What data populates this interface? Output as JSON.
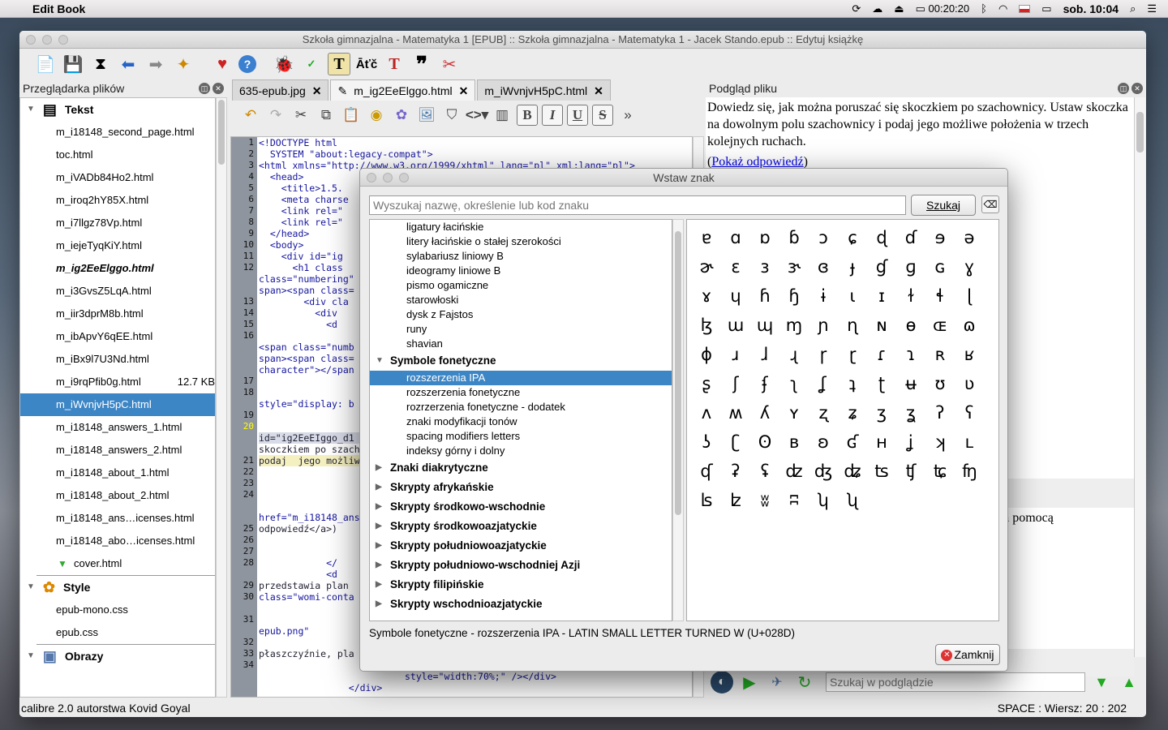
{
  "menubar": {
    "app_name": "Edit Book",
    "time_badge": "00:20:20",
    "clock": "sob. 10:04"
  },
  "window": {
    "title": "Szkoła gimnazjalna - Matematyka 1 [EPUB] :: Szkoła gimnazjalna - Matematyka 1 - Jacek Stando.epub :: Edytuj książkę"
  },
  "file_browser": {
    "title": "Przeglądarka plików",
    "text_category": "Tekst",
    "files": [
      {
        "name": "m_i18148_second_page.html"
      },
      {
        "name": "toc.html"
      },
      {
        "name": "m_iVADb84Ho2.html"
      },
      {
        "name": "m_iroq2hY85X.html"
      },
      {
        "name": "m_i7llgz78Vp.html"
      },
      {
        "name": "m_iejeTyqKiY.html"
      },
      {
        "name": "m_ig2EeElggo.html"
      },
      {
        "name": "m_i3GvsZ5LqA.html"
      },
      {
        "name": "m_iir3dprM8b.html"
      },
      {
        "name": "m_ibApvY6qEE.html"
      },
      {
        "name": "m_iBx9l7U3Nd.html"
      },
      {
        "name": "m_i9rqPfib0g.html",
        "size": "12.7 KB"
      },
      {
        "name": "m_iWvnjvH5pC.html"
      },
      {
        "name": "m_i18148_answers_1.html"
      },
      {
        "name": "m_i18148_answers_2.html"
      },
      {
        "name": "m_i18148_about_1.html"
      },
      {
        "name": "m_i18148_about_2.html"
      },
      {
        "name": "m_i18148_ans…icenses.html"
      },
      {
        "name": "m_i18148_abo…icenses.html"
      },
      {
        "name": "cover.html"
      }
    ],
    "style_category": "Style",
    "styles": [
      {
        "name": "epub-mono.css"
      },
      {
        "name": "epub.css"
      }
    ],
    "images_category": "Obrazy"
  },
  "editor": {
    "tabs": [
      {
        "label": "635-epub.jpg"
      },
      {
        "label": "m_ig2EeElggo.html"
      },
      {
        "label": "m_iWvnjvH5pC.html"
      }
    ],
    "line_numbers": [
      "1",
      "2",
      "3",
      "4",
      "5",
      "6",
      "7",
      "8",
      "9",
      "10",
      "11",
      "12",
      "",
      "",
      "13",
      "14",
      "15",
      "16",
      "",
      "",
      "",
      "17",
      "18",
      "",
      "19",
      "20",
      "",
      "",
      "21",
      "22",
      "23",
      "24",
      "",
      "",
      "25",
      "26",
      "27",
      "28",
      "",
      "29",
      "30",
      "",
      "31",
      "",
      "32",
      "33",
      "34"
    ],
    "code_lines": [
      {
        "text": "<!DOCTYPE html",
        "c": "t"
      },
      {
        "text": "  SYSTEM \"about:legacy-compat\">",
        "c": "t"
      },
      {
        "text": "<html xmlns=\"http://www.w3.org/1999/xhtml\" lang=\"pl\" xml:lang=\"pl\">",
        "c": "t"
      },
      {
        "text": "  <head>",
        "c": "t"
      },
      {
        "text": "    <title>1.5.",
        "c": "t"
      },
      {
        "text": "    <meta charse",
        "c": "t"
      },
      {
        "text": "    <link rel=\"",
        "c": "t"
      },
      {
        "text": "    <link rel=\"",
        "c": "t"
      },
      {
        "text": "  </head>",
        "c": "t"
      },
      {
        "text": "  <body>",
        "c": "t"
      },
      {
        "text": "    <div id=\"ig",
        "c": "t"
      },
      {
        "text": "      <h1 class",
        "c": "t"
      },
      {
        "text": "class=\"numbering\"",
        "c": "t"
      },
      {
        "text": "span><span class=",
        "c": "t"
      },
      {
        "text": "        <div cla",
        "c": "t"
      },
      {
        "text": "          <div ",
        "c": "t"
      },
      {
        "text": "            <d",
        "c": "t"
      },
      {
        "text": "",
        "c": ""
      },
      {
        "text": "<span class=\"numb",
        "c": "t"
      },
      {
        "text": "span><span class=",
        "c": "t"
      },
      {
        "text": "character\"></span",
        "c": "t"
      },
      {
        "text": "",
        "c": ""
      },
      {
        "text": "",
        "c": ""
      },
      {
        "text": "style=\"display: b",
        "c": "t"
      },
      {
        "text": "",
        "c": ""
      },
      {
        "text": "",
        "c": ""
      },
      {
        "text": "id=\"ig2EeEIggo_d1",
        "c": "hb"
      },
      {
        "text": "skoczkiem po szach",
        "c": ""
      },
      {
        "text": "podaj  jego możliw",
        "c": "hl"
      },
      {
        "text": "",
        "c": ""
      },
      {
        "text": "",
        "c": ""
      },
      {
        "text": "",
        "c": ""
      },
      {
        "text": "",
        "c": ""
      },
      {
        "text": "href=\"m_i18148_ans",
        "c": "t"
      },
      {
        "text": "odpowiedź</a>)",
        "c": ""
      },
      {
        "text": "",
        "c": ""
      },
      {
        "text": "",
        "c": ""
      },
      {
        "text": "            </",
        "c": "t"
      },
      {
        "text": "            <d",
        "c": "t"
      },
      {
        "text": "przedstawia plan ",
        "c": ""
      },
      {
        "text": "class=\"womi-conta",
        "c": "t"
      },
      {
        "text": "",
        "c": ""
      },
      {
        "text": "",
        "c": ""
      },
      {
        "text": "epub.png\"",
        "c": "t"
      },
      {
        "text": "",
        "c": ""
      },
      {
        "text": "płaszczyźnie, pla",
        "c": ""
      },
      {
        "text": "",
        "c": ""
      },
      {
        "text": "                          style=\"width:70%;\" /></div>",
        "c": "t"
      },
      {
        "text": "                </div>",
        "c": "t"
      }
    ]
  },
  "preview": {
    "title": "Podgląd pliku",
    "paragraph": "Dowiedz się, jak można poruszać się skoczkiem po szachownicy. Ustaw skoczka na dowolnym polu szachownicy i podaj jego możliwe położenia w trzech kolejnych ruchach.",
    "link_open": "(",
    "link_text": "Pokaż odpowiedź",
    "link_close": ")",
    "partial_text": "za pomocą",
    "search_placeholder": "Szukaj w podglądzie"
  },
  "status": {
    "left": "calibre 2.0 autorstwa Kovid Goyal",
    "right": "SPACE : Wiersz: 20 : 202"
  },
  "dialog": {
    "title": "Wstaw znak",
    "search_placeholder": "Wyszukaj nazwę, określenie lub kod znaku",
    "search_button": "Szukaj",
    "tree_items": [
      {
        "label": "ligatury łacińskie",
        "kind": "child"
      },
      {
        "label": "litery łacińskie o stałej szerokości",
        "kind": "child"
      },
      {
        "label": "sylabariusz liniowy B",
        "kind": "child"
      },
      {
        "label": "ideogramy liniowe B",
        "kind": "child"
      },
      {
        "label": "pismo ogamiczne",
        "kind": "child"
      },
      {
        "label": "starowłoski",
        "kind": "child"
      },
      {
        "label": "dysk z Fajstos",
        "kind": "child"
      },
      {
        "label": "runy",
        "kind": "child"
      },
      {
        "label": "shavian",
        "kind": "child"
      },
      {
        "label": "Symbole fonetyczne",
        "kind": "cat",
        "arrow": "▼"
      },
      {
        "label": "rozszerzenia IPA",
        "kind": "child",
        "sel": true
      },
      {
        "label": "rozszerzenia fonetyczne",
        "kind": "child"
      },
      {
        "label": "rozrzerzenia fonetyczne - dodatek",
        "kind": "child"
      },
      {
        "label": "znaki modyfikacji tonów",
        "kind": "child"
      },
      {
        "label": "spacing modifiers letters",
        "kind": "child"
      },
      {
        "label": "indeksy górny i dolny",
        "kind": "child"
      },
      {
        "label": "Znaki diakrytyczne",
        "kind": "cat",
        "arrow": "▶"
      },
      {
        "label": "Skrypty afrykańskie",
        "kind": "cat",
        "arrow": "▶"
      },
      {
        "label": "Skrypty środkowo-wschodnie",
        "kind": "cat",
        "arrow": "▶"
      },
      {
        "label": "Skrypty środkowoazjatyckie",
        "kind": "cat",
        "arrow": "▶"
      },
      {
        "label": "Skrypty południowoazjatyckie",
        "kind": "cat",
        "arrow": "▶"
      },
      {
        "label": "Skrypty południowo-wschodniej Azji",
        "kind": "cat",
        "arrow": "▶"
      },
      {
        "label": "Skrypty filipińskie",
        "kind": "cat",
        "arrow": "▶"
      },
      {
        "label": "Skrypty wschodnioazjatyckie",
        "kind": "cat",
        "arrow": "▶"
      }
    ],
    "chars": [
      "ɐ",
      "ɑ",
      "ɒ",
      "ɓ",
      "ɔ",
      "ɕ",
      "ɖ",
      "ɗ",
      "ɘ",
      "ə",
      "ɚ",
      "ɛ",
      "ɜ",
      "ɝ",
      "ɞ",
      "ɟ",
      "ɠ",
      "ɡ",
      "ɢ",
      "ɣ",
      "ɤ",
      "ɥ",
      "ɦ",
      "ɧ",
      "ɨ",
      "ɩ",
      "ɪ",
      "ɫ",
      "ɬ",
      "ɭ",
      "ɮ",
      "ɯ",
      "ɰ",
      "ɱ",
      "ɲ",
      "ɳ",
      "ɴ",
      "ɵ",
      "ɶ",
      "ɷ",
      "ɸ",
      "ɹ",
      "ɺ",
      "ɻ",
      "ɼ",
      "ɽ",
      "ɾ",
      "ɿ",
      "ʀ",
      "ʁ",
      "ʂ",
      "ʃ",
      "ʄ",
      "ʅ",
      "ʆ",
      "ʇ",
      "ʈ",
      "ʉ",
      "ʊ",
      "ʋ",
      "ʌ",
      "ʍ",
      "ʎ",
      "ʏ",
      "ʐ",
      "ʑ",
      "ʒ",
      "ʓ",
      "ʔ",
      "ʕ",
      "ʖ",
      "ʗ",
      "ʘ",
      "ʙ",
      "ʚ",
      "ʛ",
      "ʜ",
      "ʝ",
      "ʞ",
      "ʟ",
      "ʠ",
      "ʡ",
      "ʢ",
      "ʣ",
      "ʤ",
      "ʥ",
      "ʦ",
      "ʧ",
      "ʨ",
      "ʩ",
      "ʪ",
      "ʫ",
      "ʬ",
      "ʭ",
      "ʮ",
      "ʯ"
    ],
    "status": "Symbole fonetyczne - rozszerzenia IPA - LATIN SMALL LETTER TURNED W (U+028D)",
    "close_button": "Zamknij"
  }
}
